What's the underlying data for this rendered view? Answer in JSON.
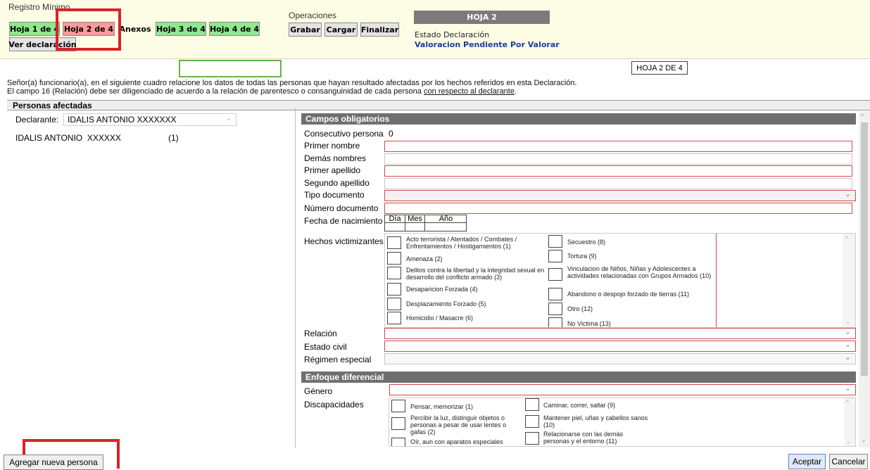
{
  "header": {
    "registro_label": "Registro Mínimo",
    "tabs": [
      {
        "label": "Hoja 1 de 4",
        "style": "green"
      },
      {
        "label": "Hoja 2 de 4",
        "style": "red"
      },
      {
        "label": "Anexos",
        "style": "plain"
      },
      {
        "label": "Hoja 3 de 4",
        "style": "green"
      },
      {
        "label": "Hoja 4 de 4",
        "style": "green"
      }
    ],
    "ver_declaracion": "Ver declaración",
    "operaciones_label": "Operaciones",
    "operaciones": [
      "Grabar",
      "Cargar",
      "Finalizar"
    ],
    "hoja_banner": "HOJA 2",
    "estado_label": "Estado Declaración",
    "estado_value": "Valoracion Pendiente Por Valorar"
  },
  "hoja_indicator": "HOJA 2 DE 4",
  "instructions": {
    "line1": "Señor(a) funcionario(a), en el siguiente cuadro relacione los datos de todas las personas que hayan resultado afectadas por los hechos referidos en esta Declaración.",
    "line2_prefix": "El campo 16 (Relación) debe ser diligenciado de acuerdo a la relación de parentesco o consanguinidad de cada persona ",
    "line2_link": "con respecto al declarante",
    "line2_suffix": "."
  },
  "personas": {
    "title": "Personas afectadas",
    "declarante_label": "Declarante:",
    "declarante_value": "IDALIS ANTONIO XXXXXXX",
    "list": [
      {
        "name": "IDALIS ANTONIO",
        "surname": "XXXXXX",
        "num": "(1)"
      }
    ]
  },
  "campos": {
    "title": "Campos obligatorios",
    "consecutivo_label": "Consecutivo persona",
    "consecutivo_value": "0",
    "primer_nombre": "Primer nombre",
    "demas_nombres": "Demás nombres",
    "primer_apellido": "Primer apellido",
    "segundo_apellido": "Segundo apellido",
    "tipo_documento": "Tipo documento",
    "numero_documento": "Número documento",
    "fecha_nacimiento": "Fecha de nacimiento",
    "date_headers": [
      "Día",
      "Mes",
      "Año"
    ],
    "hechos_label": "Hechos victimizantes",
    "hechos_left": [
      "Acto terrorista / Atentados / Combates / Enfrentamientos / Hostigamientos (1)",
      "Amenaza (2)",
      "Delitos contra la libertad y la integridad sexual en desarrollo del conflicto armado (3)",
      "Desaparicion Forzada (4)",
      "Desplazamiento Forzado (5)",
      "Homicidio / Masacre (6)"
    ],
    "hechos_right": [
      "Secuestro (8)",
      "Tortura (9)",
      "Vinculacion de Niños, Niñas y Adolescentes a actividades relacionadas con Grupos Armados (10)",
      "Abandono o despojo forzado de tierras (11)",
      "Otro (12)",
      "No Victima (13)"
    ],
    "relacion": "Relación",
    "estado_civil": "Estado civil",
    "regimen_especial": "Régimen especial"
  },
  "enfoque": {
    "title": "Enfoque diferencial",
    "genero": "Género",
    "discapacidades_label": "Discapacidades",
    "disc_left": [
      "Pensar, memorizar (1)",
      "Percibir la luz, distinguir objetos o personas a pesar de usar lentes o gafas (2)",
      "Oír, aun con aparatos especiales"
    ],
    "disc_right": [
      "Caminar, correr, saltar (9)",
      "Mantener piel, uñas y cabellos sanos (10)",
      "Relacionarse con las demás personas y el entorno (11)"
    ]
  },
  "footer": {
    "agregar": "Agregar nueva persona",
    "aceptar": "Aceptar",
    "cancelar": "Cancelar"
  }
}
